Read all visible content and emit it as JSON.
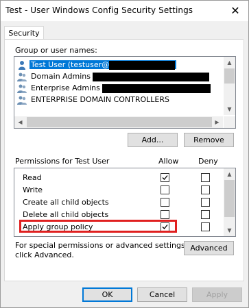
{
  "window": {
    "title": "Test - User Windows Config Security Settings",
    "close_glyph": "✕"
  },
  "tabs": [
    {
      "label": "Security",
      "selected": true
    }
  ],
  "groups": {
    "label": "Group or user names:",
    "items": [
      {
        "name": "Test User (testuser@",
        "selected": true,
        "icon": "user-icon"
      },
      {
        "name": "Domain Admins",
        "selected": false,
        "icon": "group-icon"
      },
      {
        "name": "Enterprise Admins",
        "selected": false,
        "icon": "group-icon"
      },
      {
        "name": "ENTERPRISE DOMAIN CONTROLLERS",
        "selected": false,
        "icon": "group-icon"
      }
    ]
  },
  "buttons": {
    "add": "Add...",
    "remove": "Remove",
    "advanced": "Advanced",
    "ok": "OK",
    "cancel": "Cancel",
    "apply": "Apply"
  },
  "permissions": {
    "label": "Permissions for Test User",
    "allow_header": "Allow",
    "deny_header": "Deny",
    "rows": [
      {
        "name": "Read",
        "allow": true,
        "deny": false
      },
      {
        "name": "Write",
        "allow": false,
        "deny": false
      },
      {
        "name": "Create all child objects",
        "allow": false,
        "deny": false
      },
      {
        "name": "Delete all child objects",
        "allow": false,
        "deny": false
      },
      {
        "name": "Apply group policy",
        "allow": true,
        "deny": false,
        "highlighted": true
      }
    ]
  },
  "advanced_note": "For special permissions or advanced settings, click Advanced.",
  "advanced_note_line1": "For special permissions or advanced settings,",
  "advanced_note_line2": "click Advanced.",
  "colors": {
    "selection": "#0078d7",
    "highlight_border": "#e02020"
  }
}
